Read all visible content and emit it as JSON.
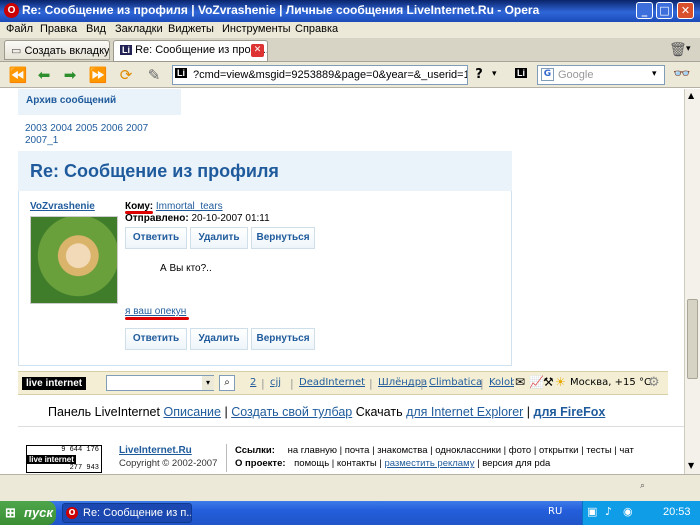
{
  "window": {
    "title": "Re: Сообщение из профиля | VoZvrashenie | Личные сообщения LiveInternet.Ru - Opera"
  },
  "menu": [
    "Файл",
    "Правка",
    "Вид",
    "Закладки",
    "Виджеты",
    "Инструменты",
    "Справка"
  ],
  "tabs": {
    "new_tab": "Создать вкладку",
    "active_tab": "Re: Сообщение из проф..."
  },
  "address": {
    "value": "?cmd=view&msgid=9253889&page=0&year=&_userid=1679930",
    "search_placeholder": "Google"
  },
  "archive": {
    "label": "Архив сообщений",
    "years": [
      "2003",
      "2004",
      "2005",
      "2006",
      "2007",
      "2007_1"
    ]
  },
  "message": {
    "title": "Re: Сообщение из профиля",
    "author": "VoZvrashenie",
    "to_label": "Кому:",
    "to_user": "Immortal_tears",
    "sent_label": "Отправлено:",
    "sent_value": "20-10-2007 01:11",
    "reply_button": "Ответить",
    "delete_button": "Удалить",
    "back_button": "Вернуться",
    "body": "А Вы кто?..",
    "reply_text": "я ваш опекун"
  },
  "li_toolbar": {
    "counter": "2",
    "links": [
      "cjj",
      "DeadInternet",
      "Шлёндра",
      "Climbatica",
      "Kolob"
    ],
    "weather": "Москва, +15 °С"
  },
  "promo": {
    "prefix": "Панель LiveInternet",
    "describe": "Описание",
    "create": "Создать свой тулбар",
    "download": "Скачать",
    "ie": "для Internet Explorer",
    "ff": "для FireFox"
  },
  "footer": {
    "brand": "LiveInternet.Ru",
    "copyright": "Copyright © 2002-2007",
    "links_label": "Ссылки:",
    "links": [
      "на главную",
      "почта",
      "знакомства",
      "одноклассники",
      "фото",
      "открытки",
      "тесты",
      "чат"
    ],
    "about_label": "О проекте:",
    "about": [
      "помощь",
      "контакты",
      "разместить рекламу",
      "версия для pda"
    ],
    "counter_top": "9 644 176",
    "counter_bottom": "277 943",
    "logo": "live internet"
  },
  "taskbar": {
    "start": "пуск",
    "task": "Re: Сообщение из п...",
    "lang": "RU",
    "clock": "20:53"
  }
}
